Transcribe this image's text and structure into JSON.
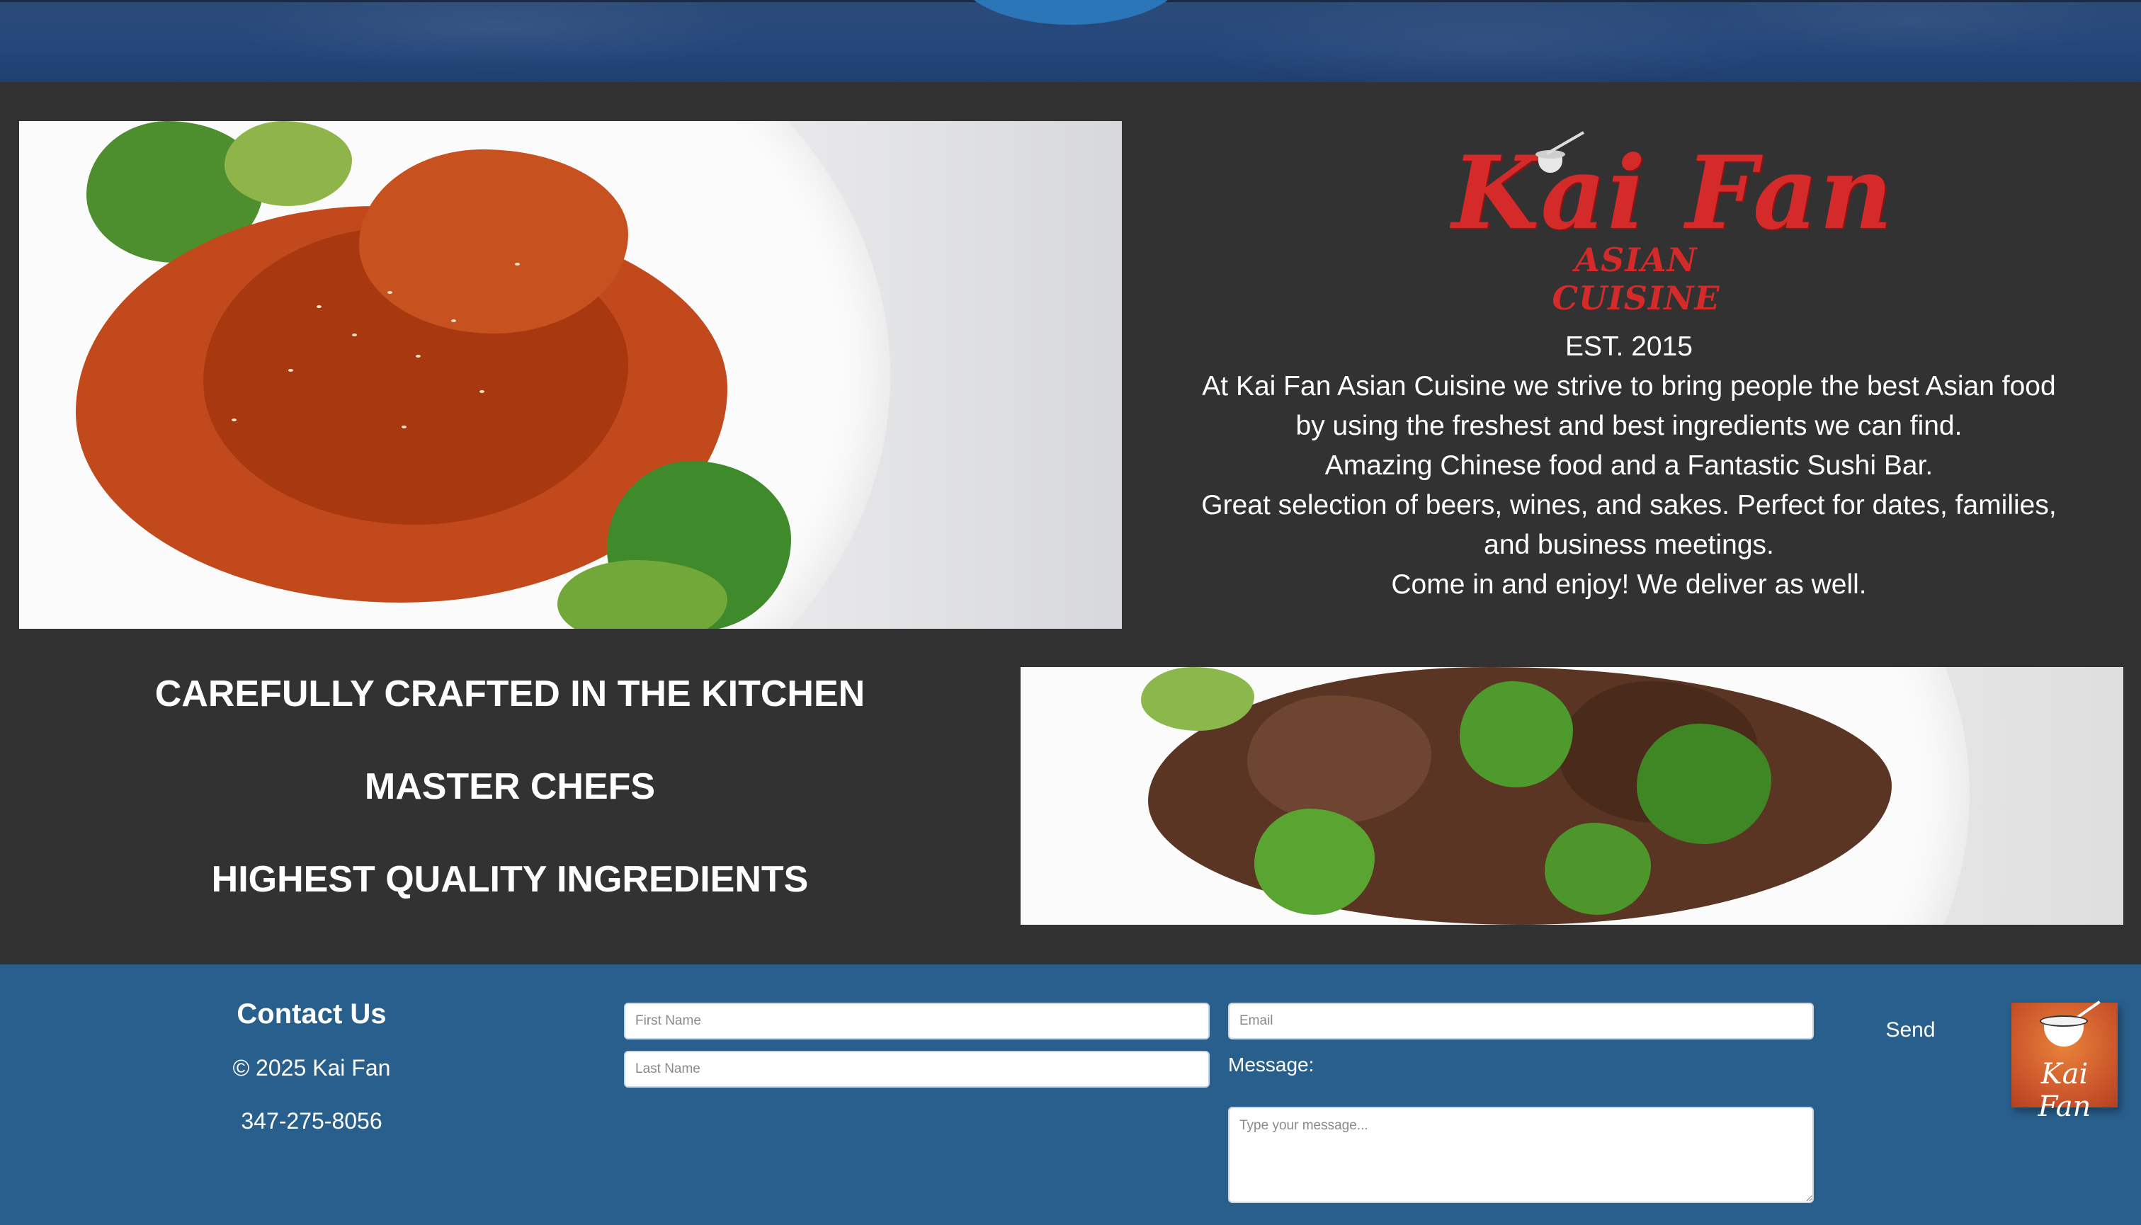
{
  "logo": {
    "word_left": "Kai",
    "word_right": "Fan",
    "subtitle": "ASIAN CUISINE"
  },
  "about": {
    "lines": [
      "EST. 2015",
      "At Kai Fan Asian Cuisine we strive to bring people the best Asian food by using the freshest and best ingredients we can find.",
      "Amazing Chinese food and a Fantastic Sushi Bar.",
      "Great selection of beers, wines, and sakes. Perfect for dates, families, and business meetings.",
      "Come in and enjoy! We deliver as well."
    ]
  },
  "features": [
    "CAREFULLY CRAFTED IN THE KITCHEN",
    "MASTER CHEFS",
    "HIGHEST QUALITY INGREDIENTS"
  ],
  "footer": {
    "contact_title": "Contact Us",
    "copyright": "© 2025 Kai Fan",
    "phone": "347-275-8056",
    "form": {
      "first_name_placeholder": "First Name",
      "last_name_placeholder": "Last Name",
      "email_placeholder": "Email",
      "message_label": "Message:",
      "message_placeholder": "Type your message...",
      "send_label": "Send"
    },
    "badge_text": "Kai Fan"
  },
  "colors": {
    "page_bg": "#323232",
    "footer_bg": "#285f8c",
    "banner_bg": "#24467a",
    "logo_red": "#d42a2a"
  }
}
